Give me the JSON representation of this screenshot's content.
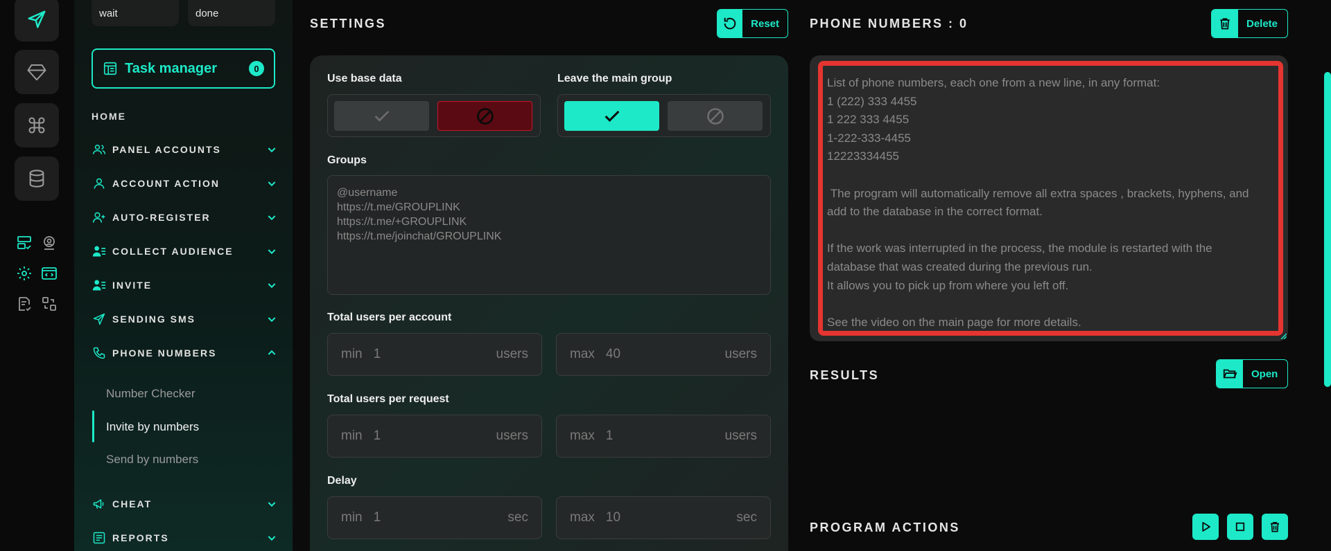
{
  "rail": {
    "icons": [
      "send-icon",
      "diamond-icon",
      "command-icon",
      "database-icon",
      "server-check-icon",
      "user-location-icon",
      "gear-icon",
      "code-window-icon",
      "document-check-icon",
      "swap-icon"
    ]
  },
  "sidebar": {
    "chips": [
      {
        "label": "wait"
      },
      {
        "label": "done"
      }
    ],
    "task_manager": {
      "label": "Task manager",
      "count": "0"
    },
    "home": "HOME",
    "items": [
      {
        "label": "PANEL ACCOUNTS",
        "icon": "users-icon",
        "chevron": "down"
      },
      {
        "label": "ACCOUNT ACTION",
        "icon": "user-icon",
        "chevron": "down"
      },
      {
        "label": "AUTO-REGISTER",
        "icon": "user-plus-icon",
        "chevron": "down"
      },
      {
        "label": "COLLECT AUDIENCE",
        "icon": "user-list-icon",
        "chevron": "down"
      },
      {
        "label": "INVITE",
        "icon": "user-list-icon",
        "chevron": "down"
      },
      {
        "label": "SENDING SMS",
        "icon": "send-icon",
        "chevron": "down"
      },
      {
        "label": "PHONE NUMBERS",
        "icon": "phone-icon",
        "chevron": "up"
      },
      {
        "label": "CHEAT",
        "icon": "megaphone-icon",
        "chevron": "down"
      },
      {
        "label": "REPORTS",
        "icon": "report-icon",
        "chevron": "down"
      }
    ],
    "phone_numbers_subitems": [
      {
        "label": "Number Checker",
        "active": false
      },
      {
        "label": "Invite by numbers",
        "active": true
      },
      {
        "label": "Send by numbers",
        "active": false
      }
    ]
  },
  "settings": {
    "title": "SETTINGS",
    "reset_label": "Reset",
    "use_base_data": {
      "label": "Use base data",
      "selected": "off"
    },
    "leave_main_group": {
      "label": "Leave the main group",
      "selected": "on"
    },
    "groups": {
      "label": "Groups",
      "placeholder": "@username\nhttps://t.me/GROUPLINK\nhttps://t.me/+GROUPLINK\nhttps://t.me/joinchat/GROUPLINK"
    },
    "total_users_per_account": {
      "label": "Total users per account",
      "min": {
        "prefix": "min",
        "value": "1",
        "unit": "users"
      },
      "max": {
        "prefix": "max",
        "value": "40",
        "unit": "users"
      }
    },
    "total_users_per_request": {
      "label": "Total users per request",
      "min": {
        "prefix": "min",
        "value": "1",
        "unit": "users"
      },
      "max": {
        "prefix": "max",
        "value": "1",
        "unit": "users"
      }
    },
    "delay": {
      "label": "Delay",
      "min": {
        "prefix": "min",
        "value": "1",
        "unit": "sec"
      },
      "max": {
        "prefix": "max",
        "value": "10",
        "unit": "sec"
      }
    }
  },
  "phone_numbers": {
    "title": "PHONE NUMBERS : 0",
    "delete_label": "Delete",
    "placeholder": "List of phone numbers, each one from a new line, in any format:\n1 (222) 333 4455\n1 222 333 4455\n1-222-333-4455\n12223334455\n\n The program will automatically remove all extra spaces , brackets, hyphens, and add to the database in the correct format.\n\nIf the work was interrupted in the process, the module is restarted with the database that was created during the previous run.\nIt allows you to pick up from where you left off.\n\nSee the video on the main page for more details."
  },
  "results": {
    "title": "RESULTS",
    "open_label": "Open"
  },
  "program_actions": {
    "title": "PROGRAM ACTIONS",
    "buttons": [
      "play-icon",
      "stop-icon",
      "trash-icon"
    ]
  },
  "colors": {
    "accent": "#1de9c8",
    "danger": "#e53530",
    "danger_dark": "#5a0a12"
  }
}
